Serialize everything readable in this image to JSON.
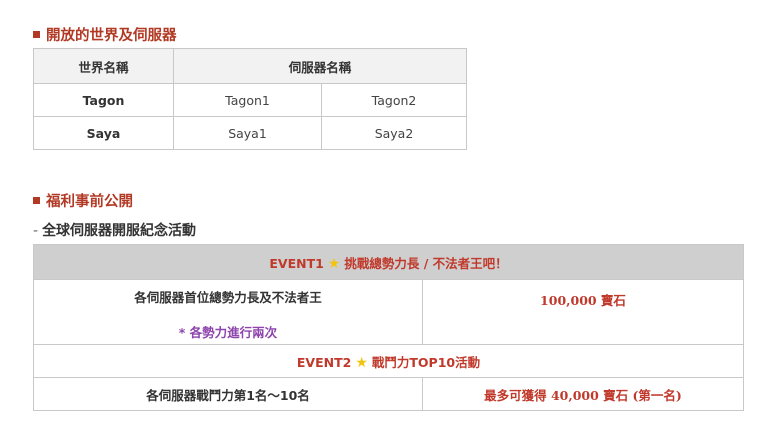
{
  "section1": {
    "title": "開放的世界及伺服器"
  },
  "server_table": {
    "headers": [
      "世界名稱",
      "伺服器名稱"
    ],
    "rows": [
      {
        "world": "Tagon",
        "servers": [
          "Tagon1",
          "Tagon2"
        ]
      },
      {
        "world": "Saya",
        "servers": [
          "Saya1",
          "Saya2"
        ]
      }
    ]
  },
  "section2": {
    "title": "福利事前公開"
  },
  "subheading": {
    "dash": "-",
    "text": "全球伺服器開服紀念活動"
  },
  "events": [
    {
      "title_prefix": "EVENT1",
      "title_text": "挑戰總勢力長 / 不法者王吧！",
      "condition": "各伺服器首位總勢力長及不法者王",
      "note": "* 各勢力進行兩次",
      "reward": "100,000 寶石"
    },
    {
      "title_prefix": "EVENT2",
      "title_text": "戰鬥力TOP10活動",
      "condition": "各伺服器戰鬥力第1名～10名",
      "reward": "最多可獲得 40,000 寶石 (第一名)"
    }
  ],
  "colors": {
    "accent": "#b23a25",
    "reward": "#c0392b",
    "note": "#8e44ad",
    "star": "#f1c40f"
  }
}
